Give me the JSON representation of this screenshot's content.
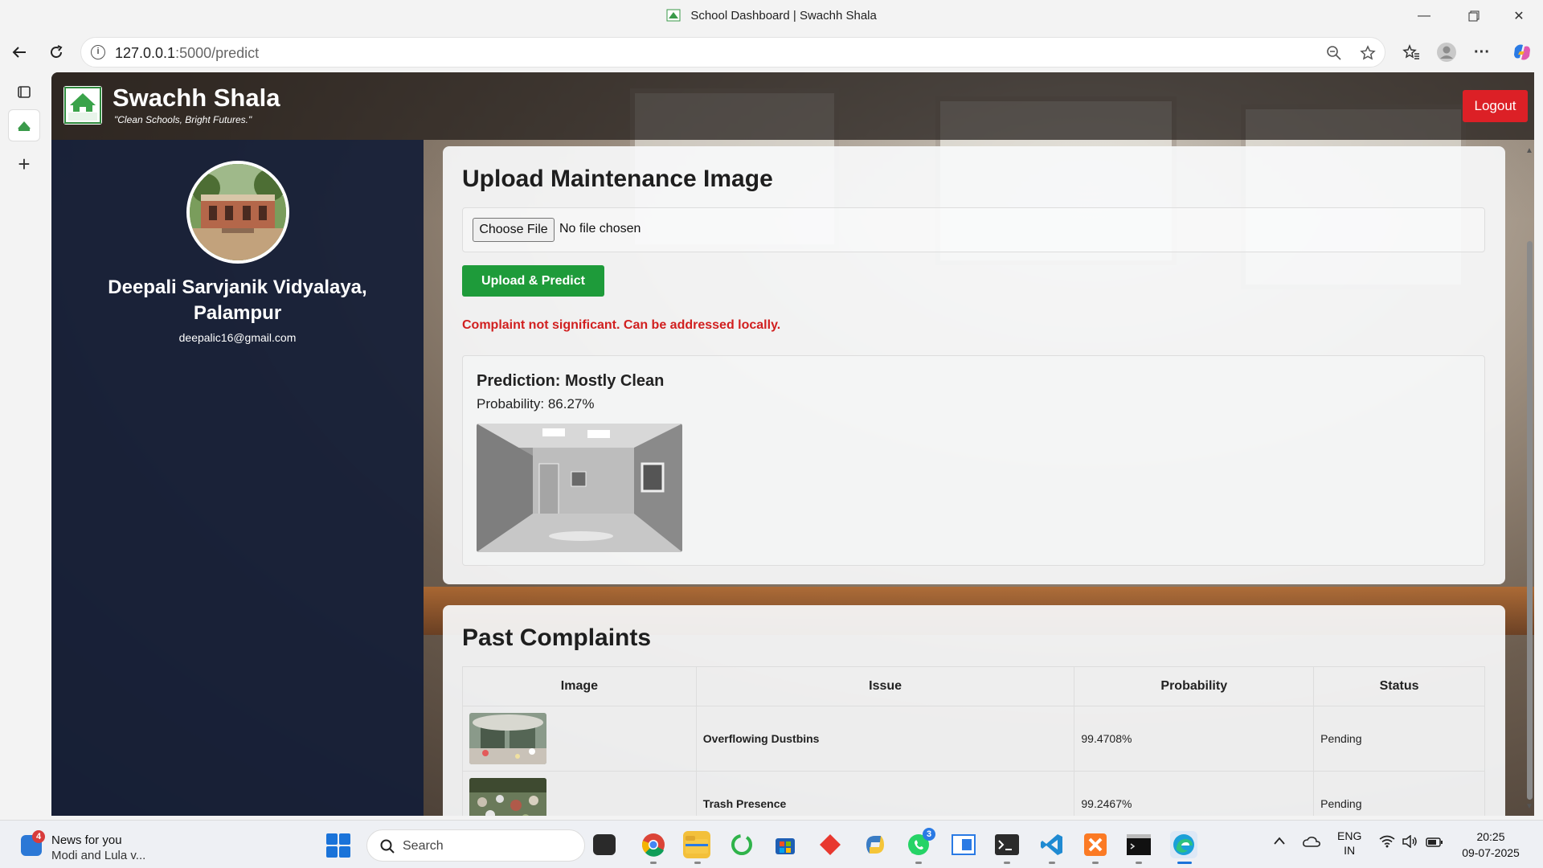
{
  "browser": {
    "tab_title": "School Dashboard | Swachh Shala",
    "url_host": "127.0.0.1",
    "url_path": ":5000/predict"
  },
  "site": {
    "brand": "Swachh Shala",
    "tagline": "\"Clean Schools, Bright Futures.\"",
    "logo_text": "Swachh Shala",
    "logout_label": "Logout"
  },
  "profile": {
    "school_name_line1": "Deepali Sarvjanik Vidyalaya,",
    "school_name_line2": "Palampur",
    "email": "deepalic16@gmail.com"
  },
  "upload": {
    "heading": "Upload Maintenance Image",
    "choose_file_label": "Choose File",
    "no_file_text": "No file chosen",
    "upload_button": "Upload & Predict",
    "message": "Complaint not significant. Can be addressed locally.",
    "prediction_label": "Prediction: Mostly Clean",
    "probability_label": "Probability: 86.27%"
  },
  "complaints": {
    "heading": "Past Complaints",
    "columns": [
      "Image",
      "Issue",
      "Probability",
      "Status"
    ],
    "rows": [
      {
        "issue": "Overflowing Dustbins",
        "probability": "99.4708%",
        "status": "Pending"
      },
      {
        "issue": "Trash Presence",
        "probability": "99.2467%",
        "status": "Pending"
      }
    ]
  },
  "taskbar": {
    "news_title": "News for you",
    "news_sub": "Modi and Lula v...",
    "news_badge": "4",
    "search_label": "Search",
    "whatsapp_badge": "3",
    "lang_line1": "ENG",
    "lang_line2": "IN",
    "time": "20:25",
    "date": "09-07-2025"
  },
  "colors": {
    "logout": "#dc2026",
    "upload_button": "#1e9b3a",
    "message": "#d11f1f",
    "profile_panel": "#14203a"
  }
}
